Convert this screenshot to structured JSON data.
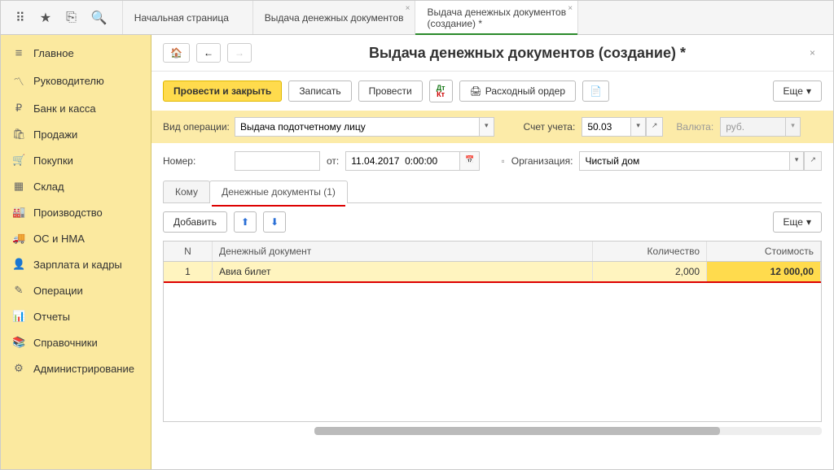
{
  "topIcons": [
    "⠿",
    "★",
    "⎘",
    "🔍"
  ],
  "tabs": [
    {
      "label": "Начальная страница"
    },
    {
      "label": "Выдача денежных документов"
    },
    {
      "label": "Выдача денежных документов",
      "sub": "(создание) *",
      "active": true
    }
  ],
  "sidebar": [
    {
      "icon": "≡",
      "label": "Главное"
    },
    {
      "icon": "〽",
      "label": "Руководителю"
    },
    {
      "icon": "₽",
      "label": "Банк и касса"
    },
    {
      "icon": "🛍",
      "label": "Продажи"
    },
    {
      "icon": "🛒",
      "label": "Покупки"
    },
    {
      "icon": "▦",
      "label": "Склад"
    },
    {
      "icon": "🏭",
      "label": "Производство"
    },
    {
      "icon": "🚚",
      "label": "ОС и НМА"
    },
    {
      "icon": "👤",
      "label": "Зарплата и кадры"
    },
    {
      "icon": "✎",
      "label": "Операции"
    },
    {
      "icon": "📊",
      "label": "Отчеты"
    },
    {
      "icon": "📚",
      "label": "Справочники"
    },
    {
      "icon": "⚙",
      "label": "Администрирование"
    }
  ],
  "doc": {
    "title": "Выдача денежных документов (создание) *",
    "buttons": {
      "post_close": "Провести и закрыть",
      "write": "Записать",
      "post": "Провести",
      "order": "Расходный ордер",
      "more": "Еще"
    },
    "fields": {
      "opType_lbl": "Вид операции:",
      "opType_val": "Выдача подотчетному лицу",
      "account_lbl": "Счет учета:",
      "account_val": "50.03",
      "currency_lbl": "Валюта:",
      "currency_val": "руб.",
      "number_lbl": "Номер:",
      "number_val": "",
      "date_lbl": "от:",
      "date_val": "11.04.2017  0:00:00",
      "org_lbl": "Организация:",
      "org_val": "Чистый дом"
    },
    "docTabs": {
      "t1": "Кому",
      "t2": "Денежные документы (1)"
    },
    "gridToolbar": {
      "add": "Добавить",
      "more": "Еще"
    },
    "gridHead": {
      "n": "N",
      "doc": "Денежный документ",
      "qty": "Количество",
      "cost": "Стоимость"
    },
    "gridRows": [
      {
        "n": "1",
        "doc": "Авиа билет",
        "qty": "2,000",
        "cost": "12 000,00"
      }
    ]
  }
}
